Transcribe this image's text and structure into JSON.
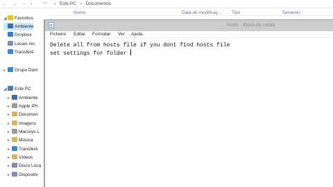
{
  "explorer": {
    "breadcrumb": [
      "Este PC",
      "Documentos"
    ],
    "columns": [
      "Nome",
      "Data de modificaç...",
      "Tipo",
      "Tamanho"
    ],
    "tree": [
      {
        "label": "Favoritos",
        "color": "#f4c20d"
      },
      {
        "label": "Ambiente",
        "color": "#3a6ea5"
      },
      {
        "label": "Dropbox",
        "color": "#2f7fd8"
      },
      {
        "label": "Locais rec",
        "color": "#7f8fa6"
      },
      {
        "label": "Transferê",
        "color": "#3b8ad9"
      },
      {
        "label": "Grupo Dom",
        "color": "#3d87c9"
      },
      {
        "label": "Este PC",
        "color": "#4a7fb5"
      },
      {
        "label": "Ambiente",
        "color": "#3a6ea5"
      },
      {
        "label": "Apple iPh",
        "color": "#9a9a9a"
      },
      {
        "label": "Documen",
        "color": "#d9b45c"
      },
      {
        "label": "Imagens",
        "color": "#d9b45c"
      },
      {
        "label": "Marusys L",
        "color": "#9a9a9a"
      },
      {
        "label": "Música",
        "color": "#d9b45c"
      },
      {
        "label": "Transferê",
        "color": "#3b8ad9"
      },
      {
        "label": "Vídeos",
        "color": "#d9b45c"
      },
      {
        "label": "Disco Loca",
        "color": "#7f8fa6"
      },
      {
        "label": "Dispositiv",
        "color": "#7f8fa6"
      }
    ]
  },
  "notepad": {
    "title": "hosts - Bloco de notas",
    "menu": [
      "Ficheiro",
      "Editar",
      "Formatar",
      "Ver",
      "Ajuda"
    ],
    "lines": [
      "Delete all from hosts file if you dont find hosts file",
      "set settings for folder "
    ]
  }
}
